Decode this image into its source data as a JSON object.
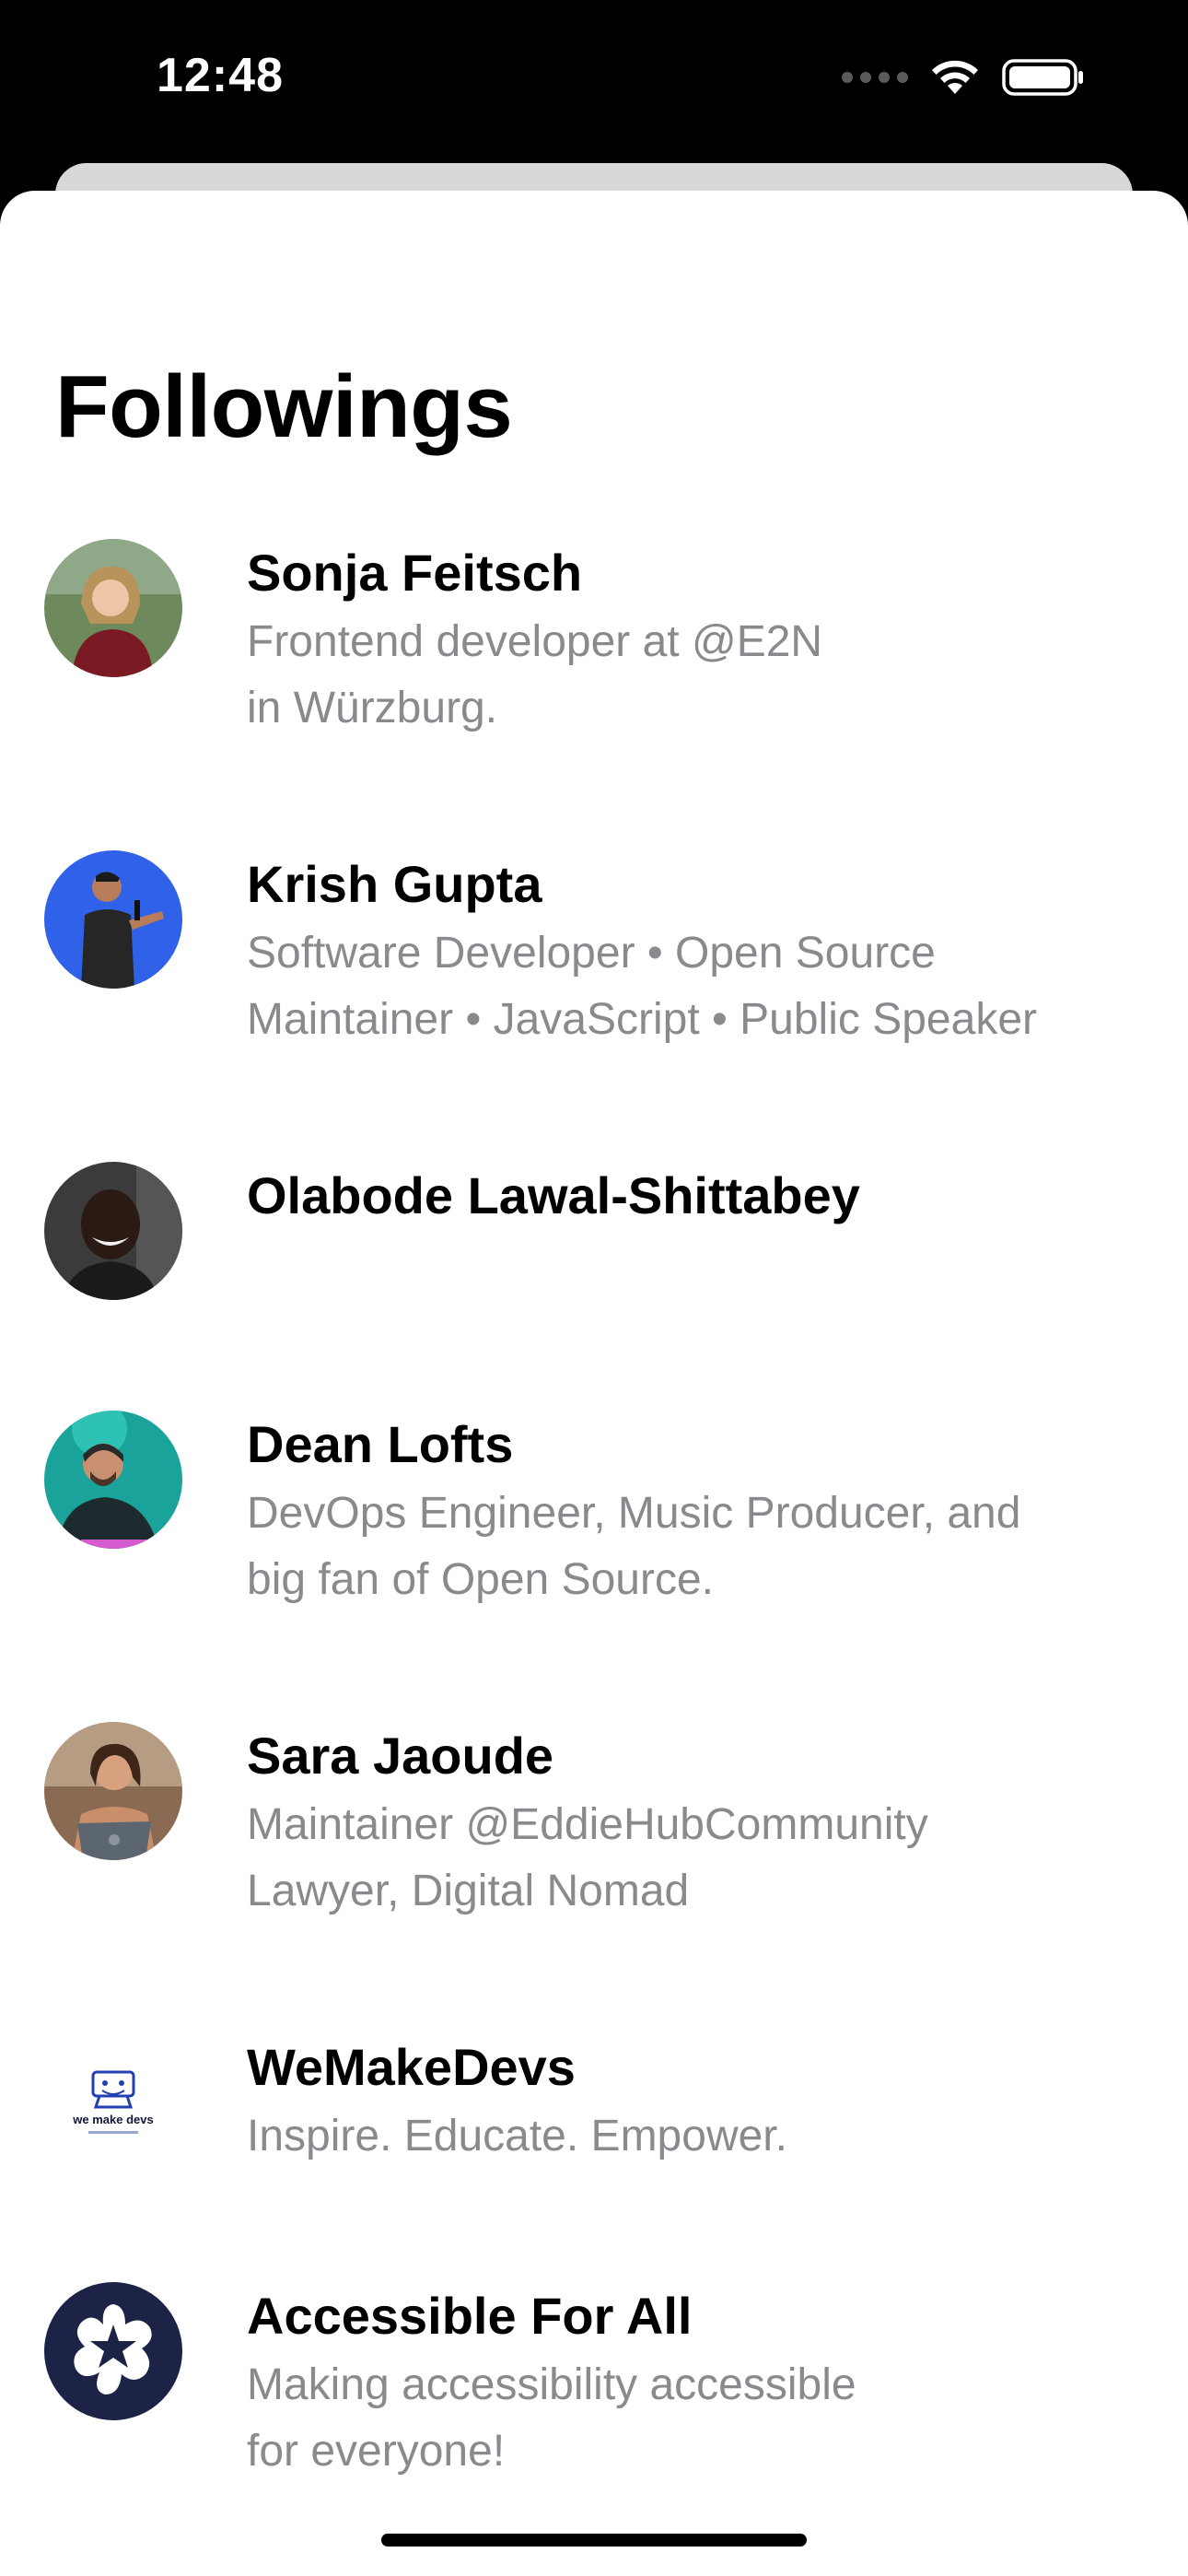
{
  "status_bar": {
    "time": "12:48"
  },
  "page": {
    "title": "Followings"
  },
  "followings": [
    {
      "name": "Sonja Feitsch",
      "bio": "Frontend developer at @E2N\nin Würzburg.",
      "avatar_icon": "person-photo-avatar"
    },
    {
      "name": "Krish Gupta",
      "bio": "Software Developer • Open Source\nMaintainer • JavaScript • Public Speaker",
      "avatar_icon": "person-photo-avatar"
    },
    {
      "name": "Olabode Lawal-Shittabey",
      "bio": "",
      "avatar_icon": "person-photo-avatar"
    },
    {
      "name": "Dean Lofts",
      "bio": "DevOps Engineer, Music Producer, and\nbig fan of Open Source.",
      "avatar_icon": "person-photo-avatar"
    },
    {
      "name": "Sara Jaoude",
      "bio": "Maintainer @EddieHubCommunity\nLawyer, Digital Nomad",
      "avatar_icon": "person-photo-avatar"
    },
    {
      "name": "WeMakeDevs",
      "bio": "Inspire. Educate. Empower.",
      "avatar_icon": "we-make-devs-logo",
      "logo_text": "we make devs"
    },
    {
      "name": "Accessible For All",
      "bio": "Making accessibility accessible\nfor everyone!",
      "avatar_icon": "star-flower-logo"
    }
  ],
  "colors": {
    "sheet_background": "#ffffff",
    "status_bar_background": "#000000",
    "secondary_text": "#8a8a8e"
  }
}
